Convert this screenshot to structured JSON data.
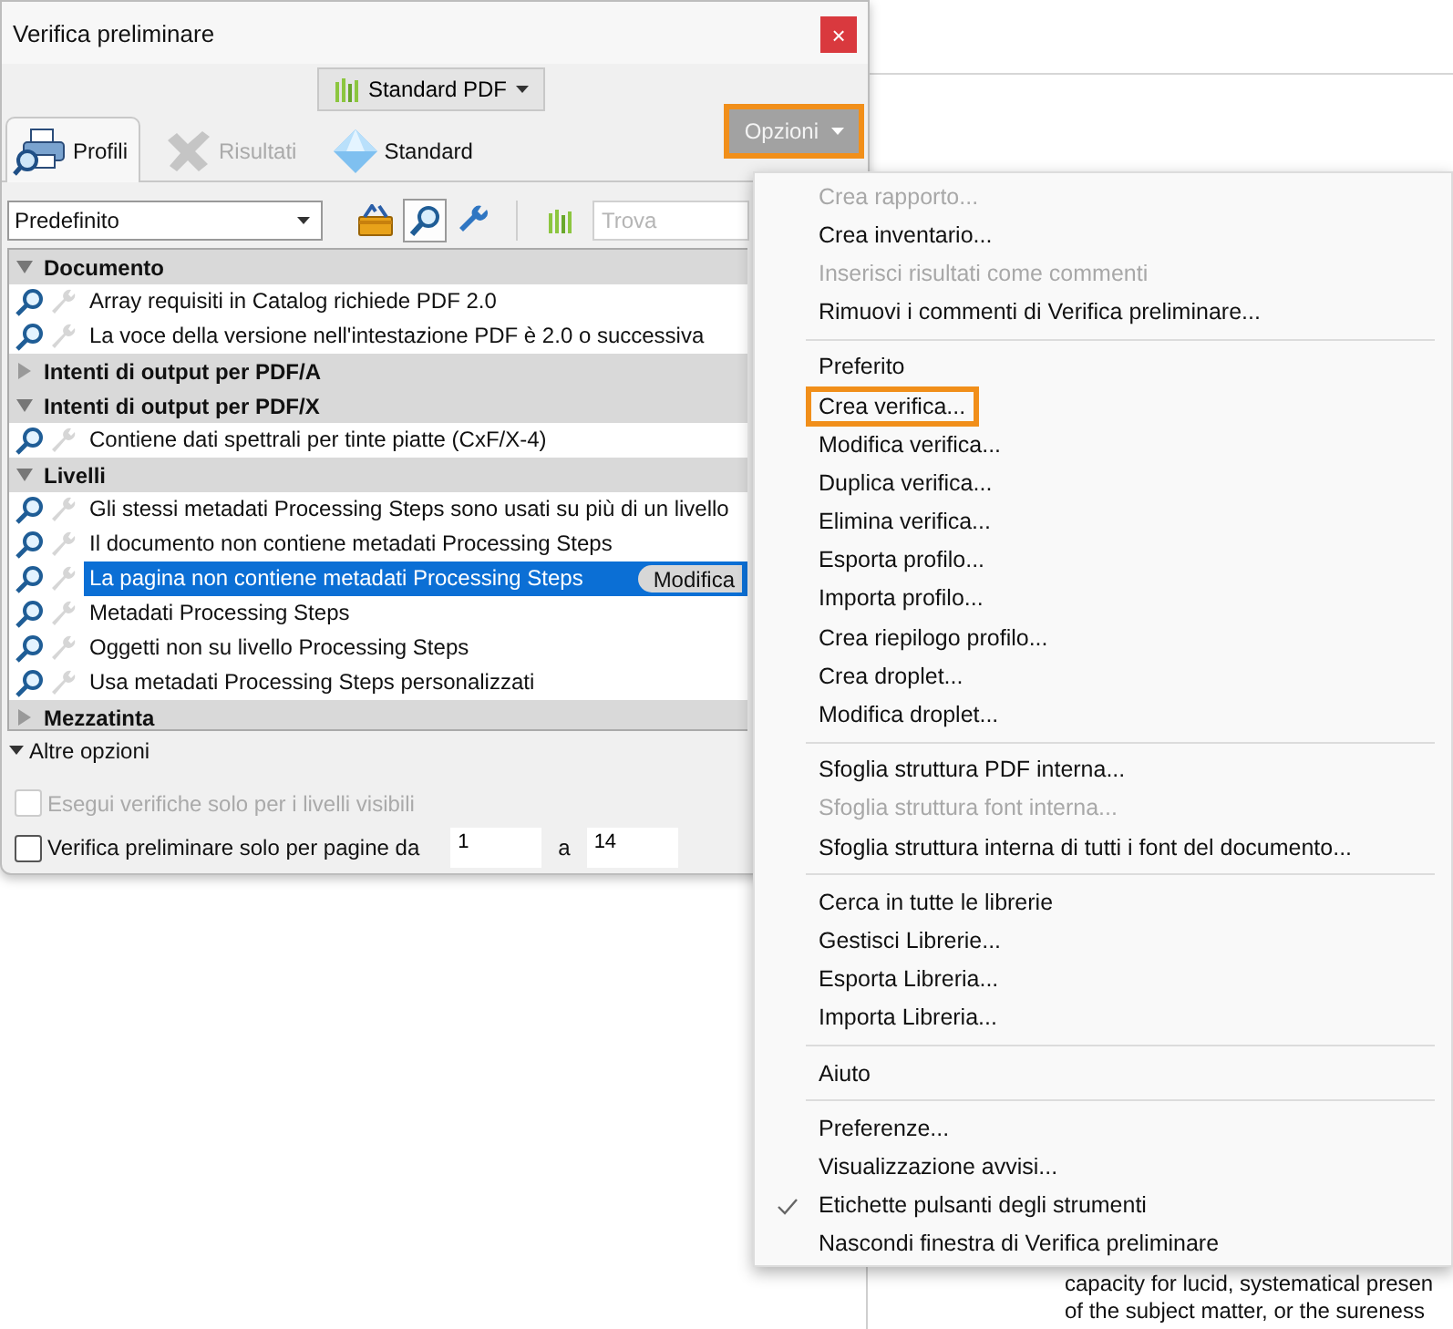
{
  "dialog": {
    "title": "Verifica preliminare",
    "close": "×",
    "standard_button": "Standard PDF",
    "tabs": [
      {
        "label": "Profili",
        "selected": true,
        "disabled": false,
        "kind": "printer"
      },
      {
        "label": "Risultati",
        "selected": false,
        "disabled": true,
        "kind": "check"
      },
      {
        "label": "Standard",
        "selected": false,
        "disabled": false,
        "kind": "diamond"
      }
    ],
    "options_button": {
      "label": "Opzioni",
      "highlighted": true
    },
    "profile_select": "Predefinito",
    "tool_buttons": [
      {
        "kind": "toolbox",
        "pressed": false
      },
      {
        "kind": "search",
        "pressed": true
      },
      {
        "kind": "wrench",
        "pressed": false
      }
    ],
    "search": {
      "placeholder": "Trova"
    },
    "groups": [
      {
        "name": "Documento",
        "expanded": true,
        "items": [
          {
            "label": "Array requisiti in Catalog richiede PDF 2.0",
            "selected": false
          },
          {
            "label": "La voce della versione nell'intestazione PDF è 2.0 o successiva",
            "selected": false
          }
        ]
      },
      {
        "name": "Intenti di output per PDF/A",
        "expanded": false
      },
      {
        "name": "Intenti di output per PDF/X",
        "expanded": true,
        "items": [
          {
            "label": "Contiene dati spettrali per tinte piatte (CxF/X-4)",
            "selected": false
          }
        ]
      },
      {
        "name": "Livelli",
        "expanded": true,
        "items": [
          {
            "label": "Gli stessi metadati Processing Steps sono usati su più di un livello",
            "selected": false
          },
          {
            "label": "Il documento non contiene metadati Processing Steps",
            "selected": false
          },
          {
            "label": "La pagina non contiene metadati Processing Steps",
            "selected": true,
            "button": "Modifica"
          },
          {
            "label": "Metadati Processing Steps",
            "selected": false
          },
          {
            "label": "Oggetti non su livello Processing Steps",
            "selected": false
          },
          {
            "label": "Usa metadati Processing Steps personalizzati",
            "selected": false
          }
        ]
      },
      {
        "name": "Mezzatinta",
        "expanded": false
      }
    ],
    "more_options": {
      "label": "Altre opzioni",
      "expanded": true
    },
    "checkboxes": [
      {
        "label": "Esegui verifiche solo per i livelli visibili",
        "checked": false,
        "disabled": true
      },
      {
        "label": "Verifica preliminare solo per pagine da",
        "checked": false,
        "disabled": false
      }
    ],
    "page_range": {
      "from": "1",
      "separator": "a",
      "to": "14"
    }
  },
  "menu": {
    "groups": [
      {
        "items": [
          {
            "label": "Crea rapporto...",
            "disabled": true,
            "checked": false,
            "highlighted": false
          },
          {
            "label": "Crea inventario...",
            "disabled": false,
            "checked": false,
            "highlighted": false
          },
          {
            "label": "Inserisci risultati come commenti",
            "disabled": true,
            "checked": false,
            "highlighted": false
          },
          {
            "label": "Rimuovi i commenti di Verifica preliminare...",
            "disabled": false,
            "checked": false,
            "highlighted": false
          }
        ]
      },
      {
        "items": [
          {
            "label": "Preferito",
            "disabled": false,
            "checked": false,
            "highlighted": false
          },
          {
            "label": "Crea verifica...",
            "disabled": false,
            "checked": false,
            "highlighted": true
          },
          {
            "label": "Modifica verifica...",
            "disabled": false,
            "checked": false,
            "highlighted": false
          },
          {
            "label": "Duplica verifica...",
            "disabled": false,
            "checked": false,
            "highlighted": false
          },
          {
            "label": "Elimina verifica...",
            "disabled": false,
            "checked": false,
            "highlighted": false
          },
          {
            "label": "Esporta profilo...",
            "disabled": false,
            "checked": false,
            "highlighted": false
          },
          {
            "label": "Importa profilo...",
            "disabled": false,
            "checked": false,
            "highlighted": false
          },
          {
            "label": "Crea riepilogo profilo...",
            "disabled": false,
            "checked": false,
            "highlighted": false
          },
          {
            "label": "Crea droplet...",
            "disabled": false,
            "checked": false,
            "highlighted": false
          },
          {
            "label": "Modifica droplet...",
            "disabled": false,
            "checked": false,
            "highlighted": false
          }
        ]
      },
      {
        "items": [
          {
            "label": "Sfoglia struttura PDF interna...",
            "disabled": false,
            "checked": false,
            "highlighted": false
          },
          {
            "label": "Sfoglia struttura font interna...",
            "disabled": true,
            "checked": false,
            "highlighted": false
          },
          {
            "label": "Sfoglia struttura interna di tutti i font del documento...",
            "disabled": false,
            "checked": false,
            "highlighted": false
          }
        ]
      },
      {
        "items": [
          {
            "label": "Cerca in tutte le librerie",
            "disabled": false,
            "checked": false,
            "highlighted": false
          },
          {
            "label": "Gestisci Librerie...",
            "disabled": false,
            "checked": false,
            "highlighted": false
          },
          {
            "label": "Esporta Libreria...",
            "disabled": false,
            "checked": false,
            "highlighted": false
          },
          {
            "label": "Importa Libreria...",
            "disabled": false,
            "checked": false,
            "highlighted": false
          }
        ]
      },
      {
        "items": [
          {
            "label": "Aiuto",
            "disabled": false,
            "checked": false,
            "highlighted": false
          }
        ]
      },
      {
        "items": [
          {
            "label": "Preferenze...",
            "disabled": false,
            "checked": false,
            "highlighted": false
          },
          {
            "label": "Visualizzazione avvisi...",
            "disabled": false,
            "checked": false,
            "highlighted": false
          },
          {
            "label": "Etichette pulsanti degli strumenti",
            "disabled": false,
            "checked": true,
            "highlighted": false
          },
          {
            "label": "Nascondi finestra di Verifica preliminare",
            "disabled": false,
            "checked": false,
            "highlighted": false
          }
        ]
      }
    ]
  },
  "document": {
    "lines": [
      "capacity for lucid, systematical presen",
      "of the subject matter, or the sureness"
    ]
  }
}
